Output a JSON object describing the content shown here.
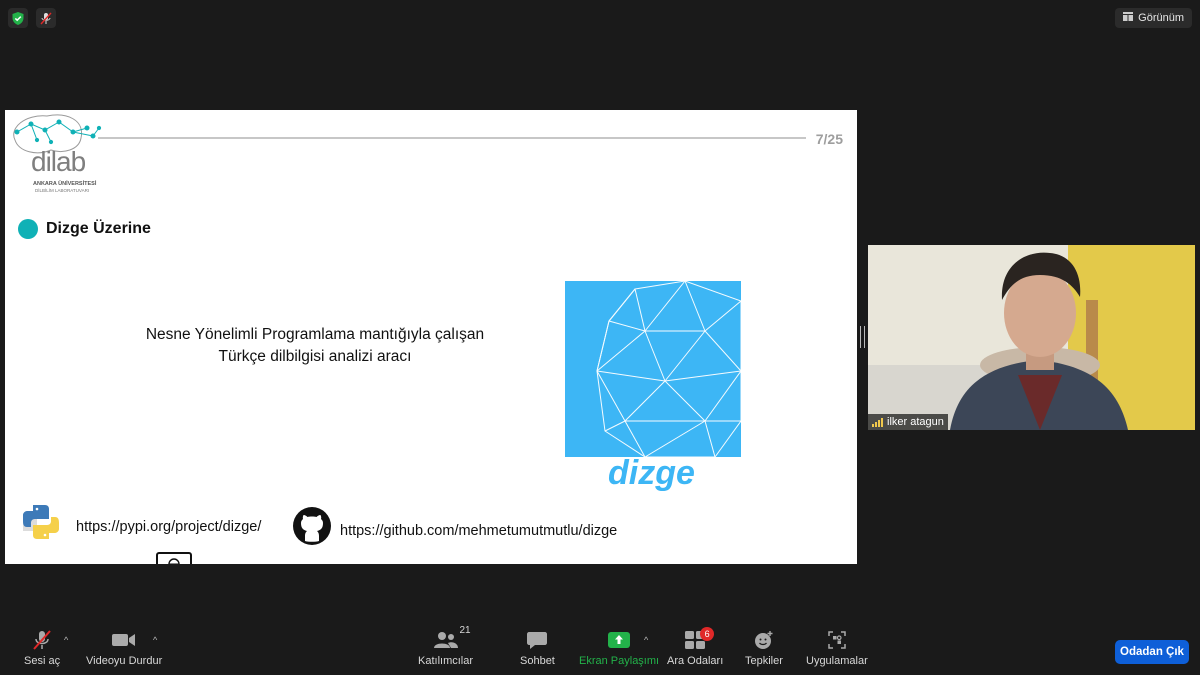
{
  "colors": {
    "accent_green": "#23b24a",
    "leave_blue": "#0e5fd8",
    "slide_teal": "#0fb1b6",
    "dizge_blue": "#3db6f5"
  },
  "top": {
    "view_label": "Görünüm"
  },
  "slide": {
    "page_number": "7/25",
    "logo": {
      "text": "dilab",
      "sub1": "ANKARA ÜNİVERSİTESİ",
      "sub2": "DİLBİLİM LABORATUVARI"
    },
    "section_title": "Dizge Üzerine",
    "description": [
      "Nesne Yönelimli Programlama mantığıyla çalışan",
      "Türkçe dilbilgisi analizi aracı"
    ],
    "brand_word": "dizge",
    "links": {
      "pypi": "https://pypi.org/project/dizge/",
      "github": "https://github.com/mehmetumutmutlu/dizge"
    }
  },
  "participant": {
    "name": "ilker atagun"
  },
  "toolbar": {
    "audio": "Sesi aç",
    "video": "Videoyu Durdur",
    "participants": "Katılımcılar",
    "participants_count": "21",
    "chat": "Sohbet",
    "share": "Ekran Paylaşımı",
    "breakout": "Ara Odaları",
    "breakout_badge": "6",
    "reactions": "Tepkiler",
    "apps": "Uygulamalar",
    "leave": "Odadan Çık"
  }
}
